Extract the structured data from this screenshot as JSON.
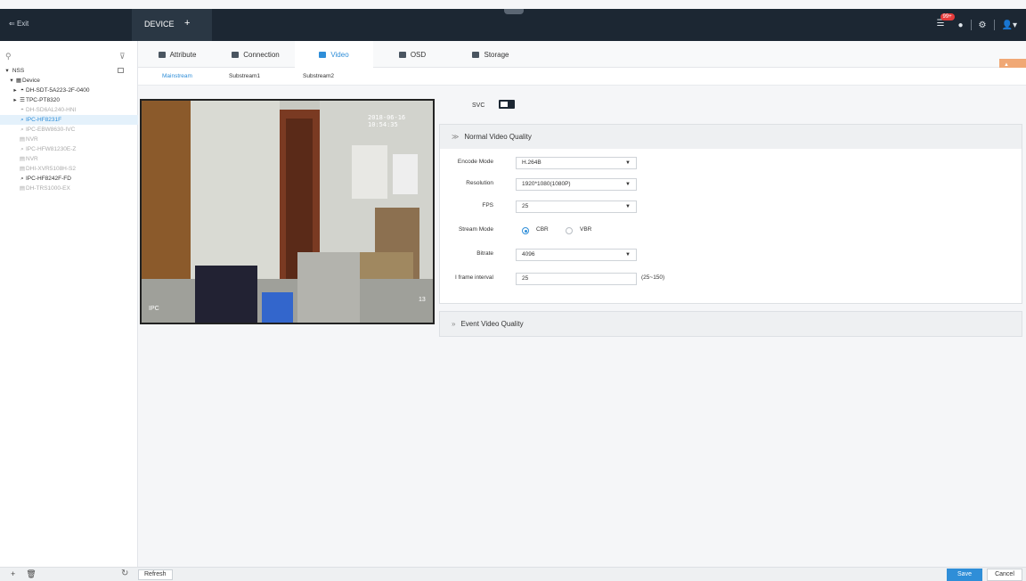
{
  "topbar": {
    "exit_label": "Exit",
    "device_tab_label": "DEVICE",
    "add_tab_symbol": "+",
    "alarm_badge": "99+"
  },
  "sidebar": {
    "search_placeholder": "",
    "root": "NSS",
    "device_group": "Device",
    "items": [
      {
        "label": "DH-SDT-5A223-2F-0400",
        "state": "online"
      },
      {
        "label": "TPC-PT8320",
        "state": "online"
      },
      {
        "label": "DH-SD6AL240-HNI",
        "state": "offline"
      },
      {
        "label": "IPC-HF8231F",
        "state": "selected"
      },
      {
        "label": "IPC-EBW8630-IVC",
        "state": "offline"
      },
      {
        "label": "NVR",
        "state": "offline"
      },
      {
        "label": "IPC-HFW81230E-Z",
        "state": "offline"
      },
      {
        "label": "NVR",
        "state": "offline"
      },
      {
        "label": "DHI-XVR5108H-S2",
        "state": "offline"
      },
      {
        "label": "IPC-HF8242F-FD",
        "state": "online"
      },
      {
        "label": "DH-TRS1000-EX",
        "state": "offline"
      }
    ]
  },
  "tabs": [
    {
      "label": "Attribute",
      "icon": "attribute-icon"
    },
    {
      "label": "Connection",
      "icon": "connection-icon"
    },
    {
      "label": "Video",
      "icon": "video-icon"
    },
    {
      "label": "OSD",
      "icon": "osd-icon"
    },
    {
      "label": "Storage",
      "icon": "storage-icon"
    }
  ],
  "active_tab": "Video",
  "subtabs": [
    "Mainstream",
    "Substream1",
    "Substream2"
  ],
  "preview": {
    "timestamp": "2018-06-16 10:54:35",
    "camera_name": "IPC",
    "channel_osd": "13"
  },
  "svc_label": "SVC",
  "normal_quality": {
    "title": "Normal Video Quality",
    "encode_mode_label": "Encode Mode",
    "encode_mode": "H.264B",
    "resolution_label": "Resolution",
    "resolution": "1920*1080(1080P)",
    "fps_label": "FPS",
    "fps": "25",
    "stream_mode_label": "Stream Mode",
    "stream_mode_options": [
      "CBR",
      "VBR"
    ],
    "stream_mode_selected": "CBR",
    "bitrate_label": "Bitrate",
    "bitrate": "4096",
    "iframe_label": "I frame interval",
    "iframe_value": "25",
    "iframe_range": "(25~150)"
  },
  "event_quality": {
    "title": "Event Video Quality"
  },
  "bottom": {
    "refresh_label": "Refresh",
    "save_label": "Save",
    "cancel_label": "Cancel"
  },
  "colors": {
    "topbar": "#1c2733",
    "accent": "#2f8ed8",
    "warning": "#f0a875"
  }
}
